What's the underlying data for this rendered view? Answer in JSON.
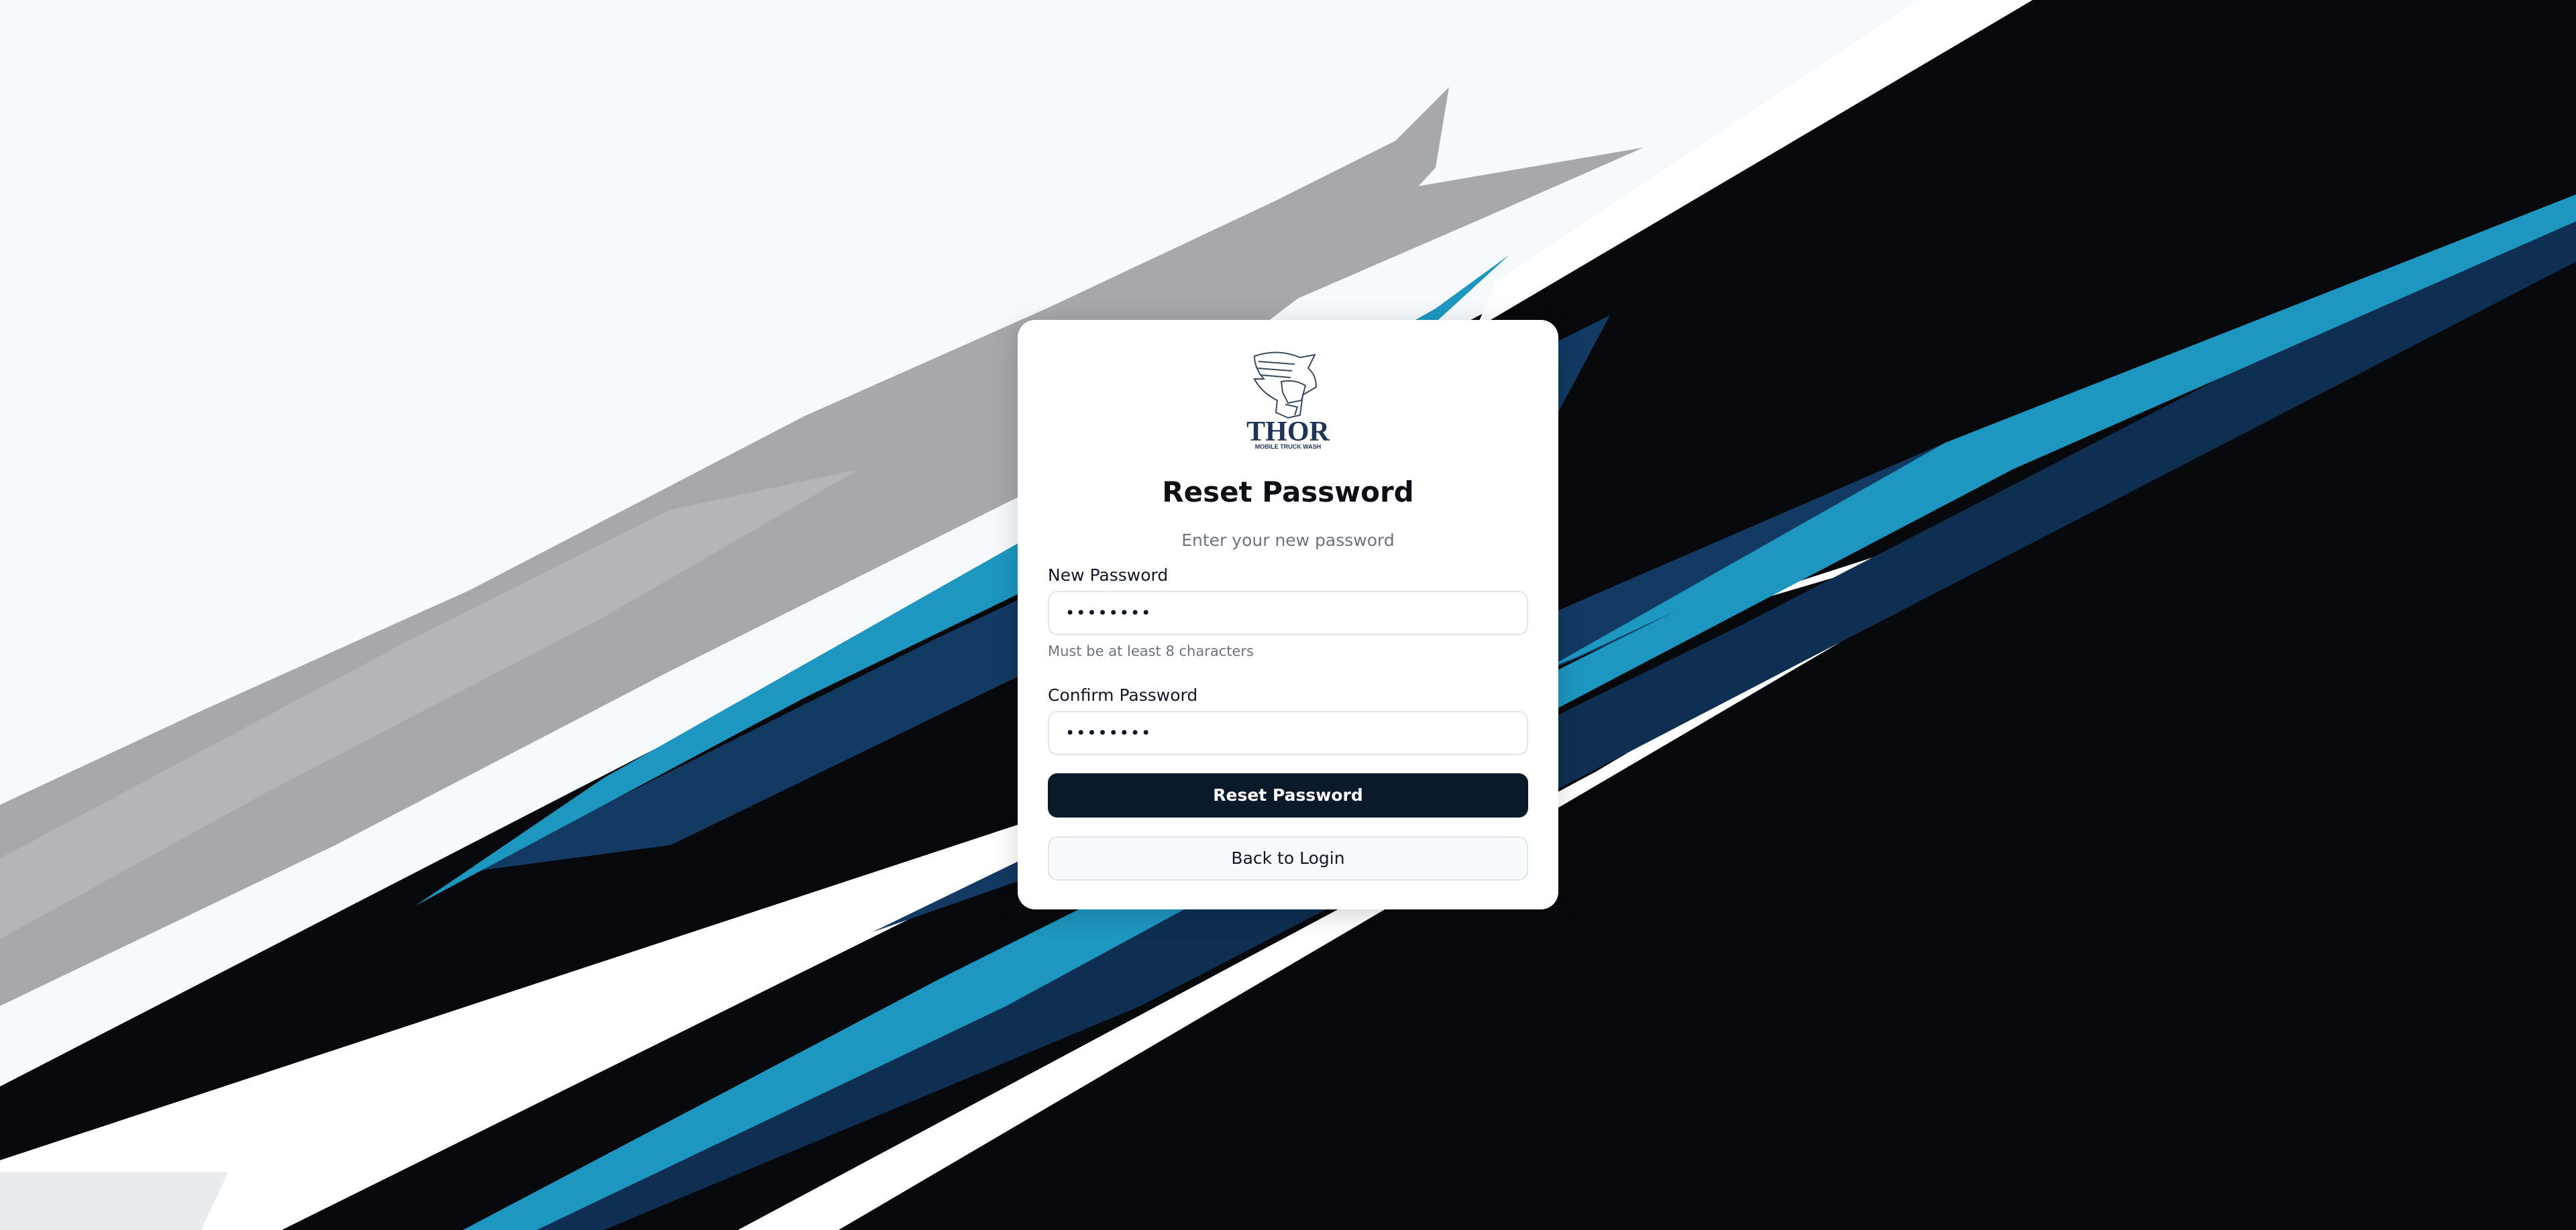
{
  "background": {
    "base": "#f6fafd",
    "dark": "#07090c",
    "blue": "#1e97c0",
    "navy": "#133a63",
    "gray": "#a7a8ab"
  },
  "logo": {
    "wordmark": "THOR",
    "tagline": "MOBILE TRUCK WASH",
    "color": "#1e3556"
  },
  "form": {
    "title": "Reset Password",
    "subtitle": "Enter your new password",
    "new_password": {
      "label": "New Password",
      "value": "••••••••",
      "hint": "Must be at least 8 characters"
    },
    "confirm_password": {
      "label": "Confirm Password",
      "value": "••••••••"
    },
    "submit_label": "Reset Password",
    "back_label": "Back to Login"
  }
}
